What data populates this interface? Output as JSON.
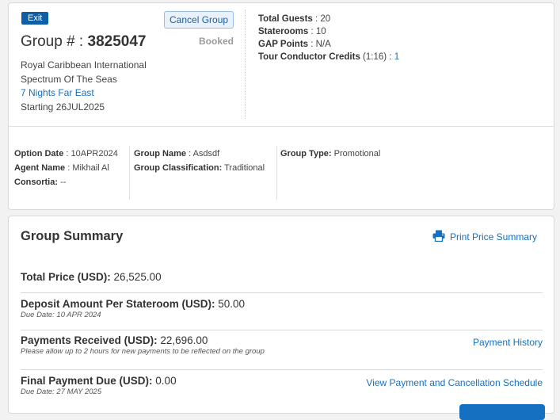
{
  "header": {
    "exit_label": "Exit",
    "cancel_label": "Cancel Group",
    "group_prefix": "Group # : ",
    "group_number": "3825047",
    "status": "Booked",
    "cruise_line": "Royal Caribbean International",
    "ship": "Spectrum Of The Seas",
    "itinerary": "7 Nights Far East",
    "start": "Starting 26JUL2025"
  },
  "stats": {
    "total_guests_label": "Total Guests",
    "total_guests": "20",
    "staterooms_label": "Staterooms",
    "staterooms": "10",
    "gap_label": "GAP Points",
    "gap": "N/A",
    "tcc_label": "Tour Conductor Credits",
    "tcc_ratio": "(1:16)",
    "tcc": "1"
  },
  "details": {
    "option_date_label": "Option Date",
    "option_date": "10APR2024",
    "agent_name_label": "Agent Name",
    "agent_name": "Mikhail Al",
    "consortia_label": "Consortia:",
    "consortia": "--",
    "group_name_label": "Group Name",
    "group_name": "Asdsdf",
    "classification_label": "Group Classification:",
    "classification": "Traditional",
    "group_type_label": "Group Type:",
    "group_type": "Promotional"
  },
  "summary": {
    "title": "Group Summary",
    "print_label": "Print Price Summary",
    "print_icon": "printer-icon",
    "total_price_label": "Total Price (USD):",
    "total_price": "26,525.00",
    "deposit_label": "Deposit Amount Per Stateroom (USD):",
    "deposit": "50.00",
    "deposit_due": "Due Date: 10 APR 2024",
    "payments_label": "Payments Received (USD):",
    "payments": "22,696.00",
    "payments_note": "Please allow up to 2 hours for new payments to be reflected on the group",
    "payment_history_label": "Payment History",
    "final_label": "Final Payment Due (USD):",
    "final": "0.00",
    "final_due": "Due Date: 27 MAY 2025",
    "schedule_label": "View Payment and Cancellation Schedule"
  },
  "colors": {
    "accent": "#0f5fa8",
    "link": "#1570c1"
  }
}
